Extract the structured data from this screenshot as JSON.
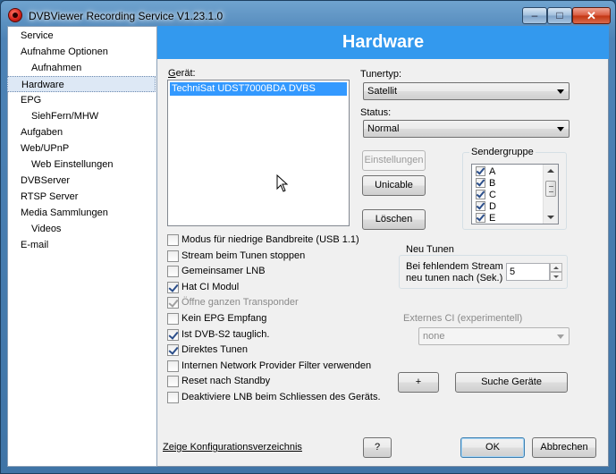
{
  "window": {
    "title": "DVBViewer Recording Service V1.23.1.0",
    "minimize_label": "–",
    "maximize_label": "□",
    "close_label": "✕"
  },
  "sidebar": {
    "items": [
      {
        "label": "Service",
        "indent": false,
        "selected": false
      },
      {
        "label": "Aufnahme Optionen",
        "indent": false,
        "selected": false
      },
      {
        "label": "Aufnahmen",
        "indent": true,
        "selected": false
      },
      {
        "label": "Hardware",
        "indent": false,
        "selected": true
      },
      {
        "label": "EPG",
        "indent": false,
        "selected": false
      },
      {
        "label": "SiehFern/MHW",
        "indent": true,
        "selected": false
      },
      {
        "label": "Aufgaben",
        "indent": false,
        "selected": false
      },
      {
        "label": "Web/UPnP",
        "indent": false,
        "selected": false
      },
      {
        "label": "Web Einstellungen",
        "indent": true,
        "selected": false
      },
      {
        "label": "DVBServer",
        "indent": false,
        "selected": false
      },
      {
        "label": "RTSP Server",
        "indent": false,
        "selected": false
      },
      {
        "label": "Media Sammlungen",
        "indent": false,
        "selected": false
      },
      {
        "label": "Videos",
        "indent": true,
        "selected": false
      },
      {
        "label": "E-mail",
        "indent": false,
        "selected": false
      }
    ]
  },
  "header": {
    "title": "Hardware"
  },
  "devices": {
    "label": "Gerät:",
    "items": [
      "TechniSat UDST7000BDA DVBS Tuner0"
    ],
    "selected_index": 0
  },
  "tuner_type": {
    "label": "Tunertyp:",
    "value": "Satellit"
  },
  "status": {
    "label": "Status:",
    "value": "Normal"
  },
  "buttons": {
    "einstellungen": "Einstellungen",
    "unicable": "Unicable",
    "loeschen": "Löschen",
    "plus": "+",
    "suche_geraete": "Suche Geräte",
    "help": "?",
    "ok": "OK",
    "abbrechen": "Abbrechen"
  },
  "sendergruppe": {
    "label": "Sendergruppe",
    "items": [
      {
        "label": "A",
        "checked": true
      },
      {
        "label": "B",
        "checked": true
      },
      {
        "label": "C",
        "checked": true
      },
      {
        "label": "D",
        "checked": true
      },
      {
        "label": "E",
        "checked": true
      }
    ]
  },
  "options": [
    {
      "label": "Modus für niedrige Bandbreite (USB 1.1)",
      "checked": false,
      "disabled": false
    },
    {
      "label": "Stream beim Tunen stoppen",
      "checked": false,
      "disabled": false
    },
    {
      "label": "Gemeinsamer LNB",
      "checked": false,
      "disabled": false
    },
    {
      "label": "Hat CI Modul",
      "checked": true,
      "disabled": false
    },
    {
      "label": "Öffne ganzen Transponder",
      "checked": true,
      "disabled": true
    },
    {
      "label": "Kein EPG Empfang",
      "checked": false,
      "disabled": false
    },
    {
      "label": "Ist DVB-S2 tauglich.",
      "checked": true,
      "disabled": false
    },
    {
      "label": "Direktes Tunen",
      "checked": true,
      "disabled": false
    },
    {
      "label": "Internen Network Provider Filter verwenden",
      "checked": false,
      "disabled": false
    },
    {
      "label": "Reset nach Standby",
      "checked": false,
      "disabled": false
    },
    {
      "label": "Deaktiviere LNB beim Schliessen des Geräts.",
      "checked": false,
      "disabled": false
    }
  ],
  "neu_tunen": {
    "label": "Neu Tunen",
    "field_label_line1": "Bei fehlendem Stream",
    "field_label_line2": "neu tunen nach (Sek.)",
    "value": "5"
  },
  "externes_ci": {
    "label": "Externes CI (experimentell)",
    "value": "none"
  },
  "config_link": "Zeige Konfigurationsverzeichnis",
  "icons": {
    "app": "dvbviewer-record-icon",
    "cursor": "mouse-pointer-icon"
  }
}
